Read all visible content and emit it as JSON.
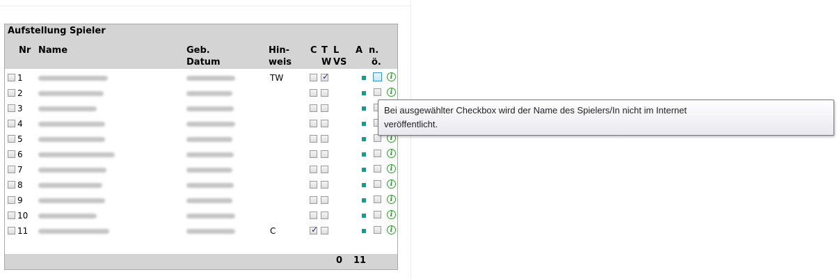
{
  "panel": {
    "title": "Aufstellung Spieler",
    "headers": {
      "nr": "Nr",
      "name": "Name",
      "geb1": "Geb.",
      "geb2": "Datum",
      "hin1": "Hin-",
      "hin2": "weis",
      "c": "C",
      "t": "T",
      "l": "L",
      "a": "A",
      "n1": "n.",
      "w": "W",
      "vs": "VS",
      "o": "ö."
    },
    "rows": [
      {
        "nr": "1",
        "hint": "TW",
        "c_checked": false,
        "t_checked": true,
        "no_pub_checked": false,
        "hover": true
      },
      {
        "nr": "2",
        "hint": "",
        "c_checked": false,
        "t_checked": false,
        "no_pub_checked": false,
        "hover": false
      },
      {
        "nr": "3",
        "hint": "",
        "c_checked": false,
        "t_checked": false,
        "no_pub_checked": false,
        "hover": false
      },
      {
        "nr": "4",
        "hint": "",
        "c_checked": false,
        "t_checked": false,
        "no_pub_checked": false,
        "hover": false
      },
      {
        "nr": "5",
        "hint": "",
        "c_checked": false,
        "t_checked": false,
        "no_pub_checked": false,
        "hover": false
      },
      {
        "nr": "6",
        "hint": "",
        "c_checked": false,
        "t_checked": false,
        "no_pub_checked": false,
        "hover": false
      },
      {
        "nr": "7",
        "hint": "",
        "c_checked": false,
        "t_checked": false,
        "no_pub_checked": false,
        "hover": false
      },
      {
        "nr": "8",
        "hint": "",
        "c_checked": false,
        "t_checked": false,
        "no_pub_checked": false,
        "hover": false
      },
      {
        "nr": "9",
        "hint": "",
        "c_checked": false,
        "t_checked": false,
        "no_pub_checked": false,
        "hover": false
      },
      {
        "nr": "10",
        "hint": "",
        "c_checked": false,
        "t_checked": false,
        "no_pub_checked": false,
        "hover": false
      },
      {
        "nr": "11",
        "hint": "C",
        "c_checked": true,
        "t_checked": false,
        "no_pub_checked": false,
        "hover": false
      }
    ],
    "totals": {
      "vs": "0",
      "a": "11"
    },
    "colors": {
      "status_square": "#1a9a8c",
      "info_icon": "#2e9a2e"
    }
  },
  "tooltip": {
    "line1": "Bei ausgewählter Checkbox wird der Name des Spielers/In nicht im Internet",
    "line2": "veröffentlicht."
  }
}
